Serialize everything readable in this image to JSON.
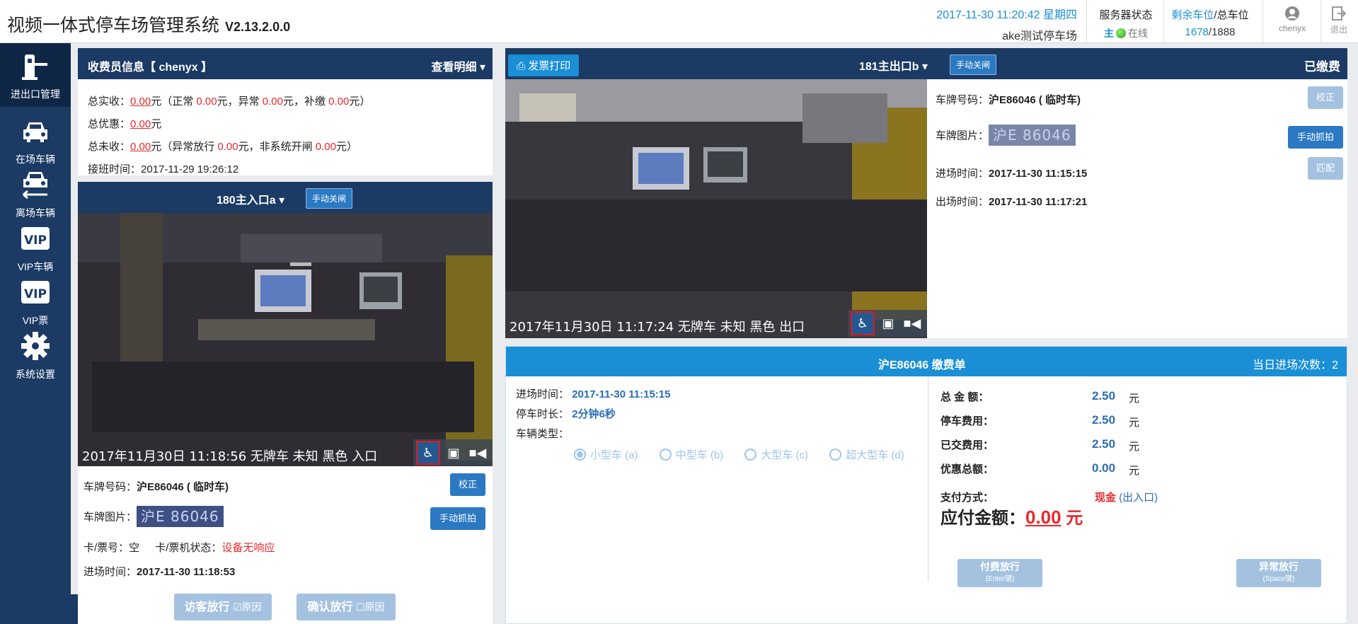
{
  "header": {
    "title": "视频一体式停车场管理系统",
    "version": "V2.13.2.0.0",
    "datetime": "2017-11-30 11:20:42 星期四",
    "lot_name": "ake测试停车场",
    "server_label": "服务器状态",
    "server_role": "主",
    "server_status": "在线",
    "spaces_label_left": "剩余车位",
    "spaces_label_right": "/总车位",
    "spaces_free": "1678",
    "spaces_total": "/1888",
    "user": "chenyx",
    "logout": "退出"
  },
  "sidebar": {
    "items": [
      {
        "label": "进出口管理",
        "icon": "barrier-gate-icon"
      },
      {
        "label": "在场车辆",
        "icon": "car-icon"
      },
      {
        "label": "离场车辆",
        "icon": "car-leave-icon"
      },
      {
        "label": "VIP车辆",
        "icon": "vip-icon"
      },
      {
        "label": "VIP票",
        "icon": "vip-ticket-icon"
      },
      {
        "label": "系统设置",
        "icon": "gear-icon"
      }
    ],
    "menu_icon": "≡"
  },
  "cashier": {
    "title": "收费员信息【 chenyx 】",
    "detail_link": "查看明细",
    "total_received_label": "总实收：",
    "total_received": "0.00",
    "yuan": "元",
    "paren_normal": "（正常 ",
    "normal": "0.00",
    "paren_abnormal": "元，异常 ",
    "abnormal": "0.00",
    "paren_supplement": "元，补缴 ",
    "supplement": "0.00",
    "paren_end": "元）",
    "discount_label": "总优惠：",
    "discount": "0.00",
    "uncollected_label": "总未收：",
    "uncollected": "0.00",
    "paren_abnormal_release": "（异常放行 ",
    "abnormal_release": "0.00",
    "paren_nonsystem": "元，非系统开闸 ",
    "nonsystem": "0.00",
    "shift_label": "接班时间：",
    "shift_time": "2017-11-29 19:26:12"
  },
  "entry": {
    "lane": "180主入口a",
    "close_btn": "手动关闸",
    "caption": "2017年11月30日 11:18:56 无牌车 未知 黑色 入口",
    "plate_label": "车牌号码：",
    "plate_value": "沪E86046 ( 临时车)",
    "correct_btn": "校正",
    "plate_img_label": "车牌图片：",
    "plate_img_text": "沪E 86046",
    "capture_btn": "手动抓拍",
    "card_label": "卡/票号：",
    "card_value": "空",
    "card_status_label": "卡/票机状态：",
    "card_status": "设备无响应",
    "entry_time_label": "进场时间：",
    "entry_time": "2017-11-30 11:18:53",
    "visitor_btn": "访客放行",
    "confirm_btn": "确认放行",
    "reason": "原因"
  },
  "exit": {
    "print_btn": "发票打印",
    "lane": "181主出口b",
    "close_btn": "手动关闸",
    "paid_status": "已缴费",
    "caption": "2017年11月30日 11:17:24 无牌车 未知 黑色 出口",
    "plate_label": "车牌号码：",
    "plate_value": "沪E86046 ( 临时车)",
    "correct_btn": "校正",
    "plate_img_label": "车牌图片：",
    "plate_img_text": "沪E 86046",
    "capture_btn": "手动抓拍",
    "match_btn": "匹配",
    "entry_label": "进场时间：",
    "entry_time": "2017-11-30 11:15:15",
    "exit_label": "出场时间：",
    "exit_time": "2017-11-30 11:17:21"
  },
  "bill": {
    "title": "沪E86046  缴费单",
    "today_count_label": "当日进场次数：",
    "today_count": "2",
    "entry_label": "进场时间：",
    "entry_time": "2017-11-30 11:15:15",
    "duration_label": "停车时长：",
    "duration": "2分钟6秒",
    "vehicle_type_label": "车辆类型：",
    "vehicle_types": [
      "小型车 (a)",
      "中型车 (b)",
      "大型车 (c)",
      "超大型车 (d)"
    ],
    "selected_type": "小型车 (a)",
    "total_label": "总 金 额：",
    "total": "2.50",
    "parking_fee_label": "停车费用：",
    "parking_fee": "2.50",
    "paid_label": "已交费用：",
    "paid": "2.50",
    "discount_label": "优惠总额：",
    "discount": "0.00",
    "yuan": "元",
    "pay_method_label": "支付方式：",
    "pay_method": "现金",
    "pay_channel": "(出入口)",
    "due_label": "应付金额：",
    "due": "0.00",
    "due_unit": "元",
    "pay_release_btn": "付费放行",
    "pay_release_key": "(Enter键)",
    "abnormal_release_btn": "异常放行",
    "abnormal_release_key": "(Space键)"
  }
}
